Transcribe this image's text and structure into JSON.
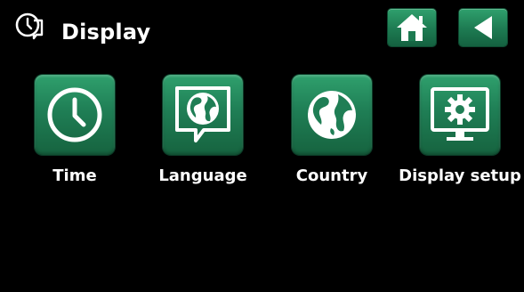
{
  "header": {
    "title": "Display",
    "icon": "display-settings-icon",
    "home_icon": "home-icon",
    "back_icon": "back-arrow-icon"
  },
  "menu": {
    "items": [
      {
        "label": "Time",
        "icon": "clock-icon"
      },
      {
        "label": "Language",
        "icon": "globe-speech-bubble-icon"
      },
      {
        "label": "Country",
        "icon": "globe-icon"
      },
      {
        "label": "Display setup",
        "icon": "monitor-gear-icon"
      }
    ]
  },
  "colors": {
    "background": "#000000",
    "accent_green": "#1f7e55",
    "text": "#ffffff"
  }
}
